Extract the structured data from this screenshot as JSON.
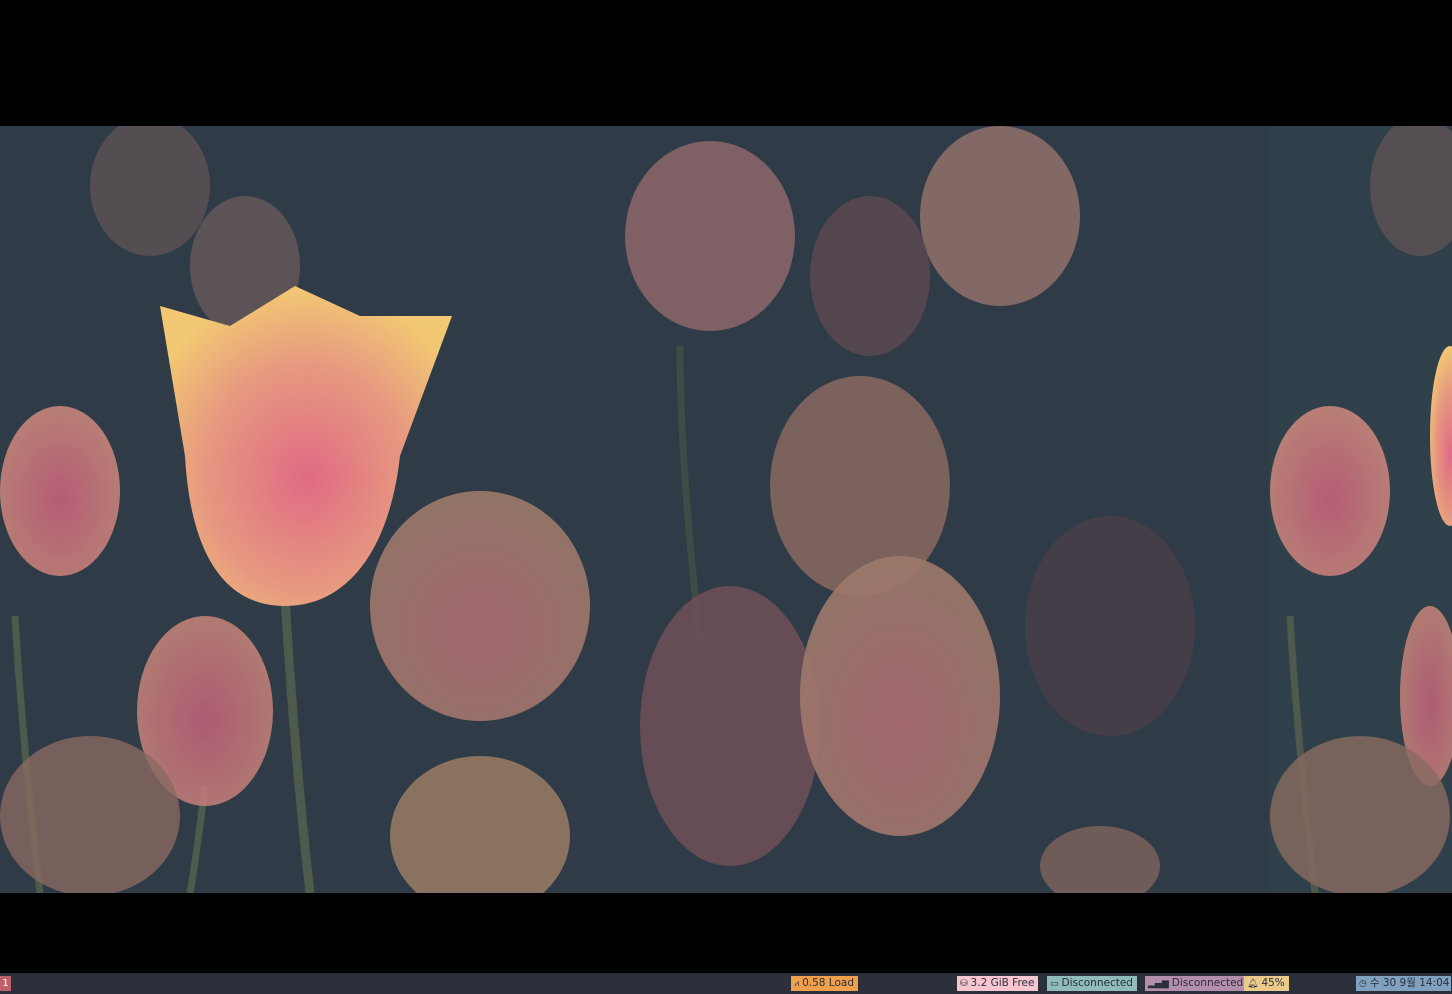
{
  "desktop": {
    "wallpaper_description_icon": "tulip-wallpaper"
  },
  "statusbar": {
    "workspace": "1",
    "load": {
      "icon": "activity-icon",
      "text": "0.58 Load"
    },
    "disk": {
      "icon": "disk-icon",
      "text": "3.2 GiB Free"
    },
    "network_wired": {
      "icon": "monitor-icon",
      "text": "Disconnected"
    },
    "network_wireless": {
      "icon": "signal-bars-icon",
      "text": "Disconnected"
    },
    "volume": {
      "icon": "bell-icon",
      "text": "45%"
    },
    "clock": {
      "icon": "clock-icon",
      "text": "수 30 9월 14:04"
    }
  },
  "colors": {
    "bar_bg": "#2b303b",
    "workspace": "#bf616a",
    "load": "#f0a04b",
    "disk": "#f7c6d0",
    "net": "#8fbcbb",
    "net2": "#b48ead",
    "volume": "#ebcb8b",
    "clock": "#81a1c1"
  }
}
